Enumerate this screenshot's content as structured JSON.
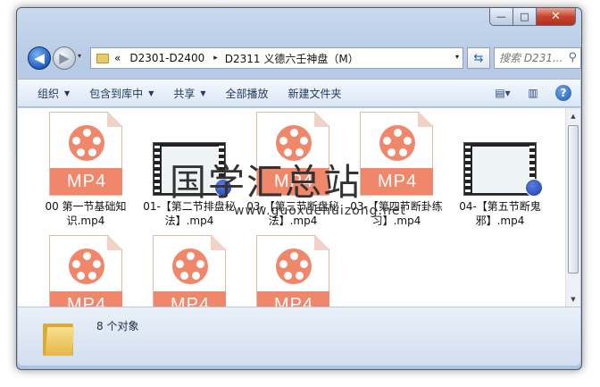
{
  "window": {
    "controls": {
      "minimize": "—",
      "maximize": "□",
      "close": "✕"
    }
  },
  "address_bar": {
    "overflow": "«",
    "segments": [
      "D2301-D2400",
      "D2311 义德六壬神盘（M）"
    ],
    "separator": "▸",
    "dropdown": "▾"
  },
  "search": {
    "placeholder": "搜索 D231..."
  },
  "toolbar": {
    "items": [
      {
        "label": "组织",
        "has_menu": true
      },
      {
        "label": "包含到库中",
        "has_menu": true
      },
      {
        "label": "共享",
        "has_menu": true
      },
      {
        "label": "全部播放",
        "has_menu": false
      },
      {
        "label": "新建文件夹",
        "has_menu": false
      }
    ],
    "view_icon": "view-icon",
    "pane_icon": "preview-pane-icon",
    "help_label": "?"
  },
  "files": [
    {
      "name": "00 第一节基础知识.mp4",
      "icon": "mp4-file-icon",
      "badge": "MP4"
    },
    {
      "name": "01-【第二节排盘秘法】.mp4",
      "icon": "video-thumbnail",
      "badge": ""
    },
    {
      "name": "03-【第三节断盘秘法】.mp4",
      "icon": "mp4-file-icon",
      "badge": "MP4"
    },
    {
      "name": "03-【第四节断卦练习】.mp4",
      "icon": "mp4-file-icon",
      "badge": "MP4"
    },
    {
      "name": "04-【第五节断鬼邪】.mp4",
      "icon": "video-thumbnail",
      "badge": ""
    },
    {
      "name": "",
      "icon": "mp4-file-icon",
      "badge": "MP4"
    },
    {
      "name": "",
      "icon": "mp4-file-icon",
      "badge": "MP4"
    },
    {
      "name": "",
      "icon": "mp4-file-icon",
      "badge": "MP4"
    }
  ],
  "watermark": {
    "text": "国学汇总站",
    "url": "www.guoxuehuizong.net"
  },
  "status": {
    "count_text": "8 个对象"
  },
  "colors": {
    "mp4_accent": "#f0876a",
    "toolbar_text": "#1e395b"
  }
}
